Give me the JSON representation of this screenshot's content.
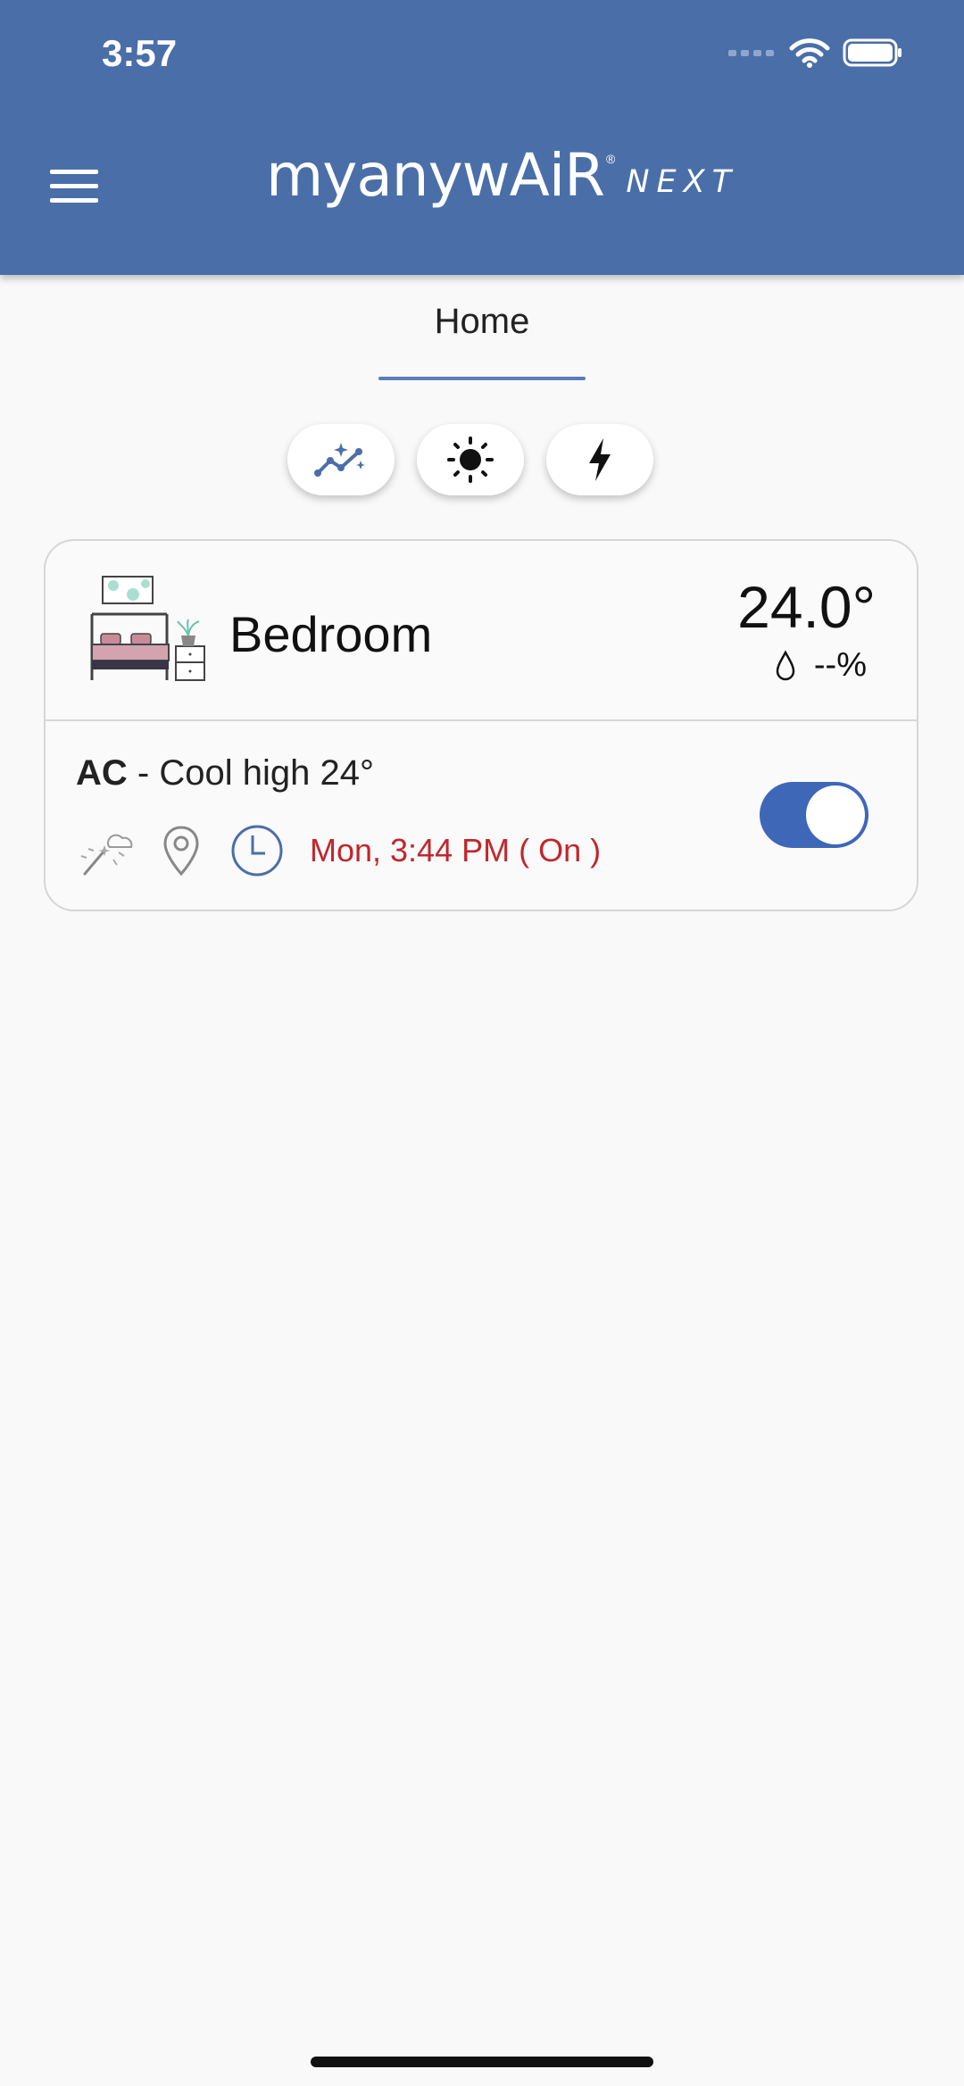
{
  "status_bar": {
    "time": "3:57"
  },
  "header": {
    "logo_main": "myanywAiR",
    "logo_reg": "®",
    "logo_suffix": "NEXT",
    "menu_icon": "hamburger-menu-icon",
    "background_color": "#4a6ea8"
  },
  "tabs": [
    {
      "label": "Home",
      "active": true
    }
  ],
  "quick_actions": [
    {
      "icon": "sparkle-trend-icon"
    },
    {
      "icon": "sun-icon"
    },
    {
      "icon": "lightning-bolt-icon"
    }
  ],
  "room": {
    "name": "Bedroom",
    "temperature": "24.0°",
    "humidity": "--%",
    "humidity_icon": "water-drop-icon",
    "room_icon": "bedroom-illustration-icon"
  },
  "ac": {
    "label": "AC",
    "mode": " - Cool high 24°",
    "icons": [
      "weather-wand-icon",
      "location-pin-icon",
      "clock-icon"
    ],
    "schedule": "Mon, 3:44 PM ( On )",
    "schedule_color": "#c0272d",
    "power_on": true,
    "toggle_color": "#3f67b8"
  }
}
